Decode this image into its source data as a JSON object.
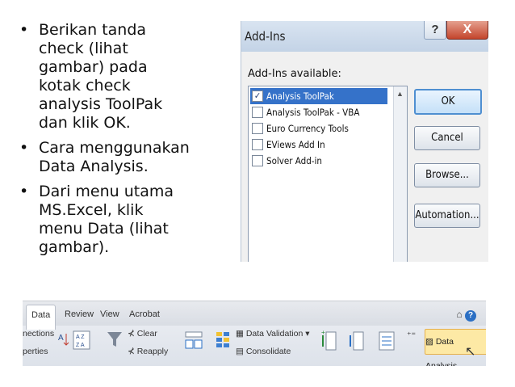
{
  "bullets": [
    "Berikan tanda\ncheck (lihat\ngambar) pada\nkotak check\nanalysis ToolPak\ndan klik OK.",
    "Cara menggunakan\nData Analysis.",
    "Dari menu utama\nMS.Excel, klik\nmenu Data (lihat\ngambar)."
  ],
  "dialog": {
    "title": "Add-Ins",
    "help_glyph": "?",
    "close_glyph": "X",
    "available_label": "Add-Ins available:",
    "items": [
      {
        "label": "Analysis ToolPak",
        "checked": true,
        "selected": true
      },
      {
        "label": "Analysis ToolPak - VBA",
        "checked": false,
        "selected": false
      },
      {
        "label": "Euro Currency Tools",
        "checked": false,
        "selected": false
      },
      {
        "label": "EViews Add In",
        "checked": false,
        "selected": false
      },
      {
        "label": "Solver Add-in",
        "checked": false,
        "selected": false
      }
    ],
    "buttons": {
      "ok": "OK",
      "cancel": "Cancel",
      "browse": "Browse...",
      "automation": "Automation..."
    }
  },
  "ribbon": {
    "tabs": [
      "Data",
      "Review",
      "View",
      "Acrobat"
    ],
    "active_tab": "Data",
    "connections_fragment": "nections",
    "properties_fragment": "perties",
    "clear_label": "Clear",
    "reapply_label": "Reapply",
    "data_validation_label": "Data Validation",
    "consolidate_label": "Consolidate",
    "data_analysis_label": "Data Analysis"
  }
}
